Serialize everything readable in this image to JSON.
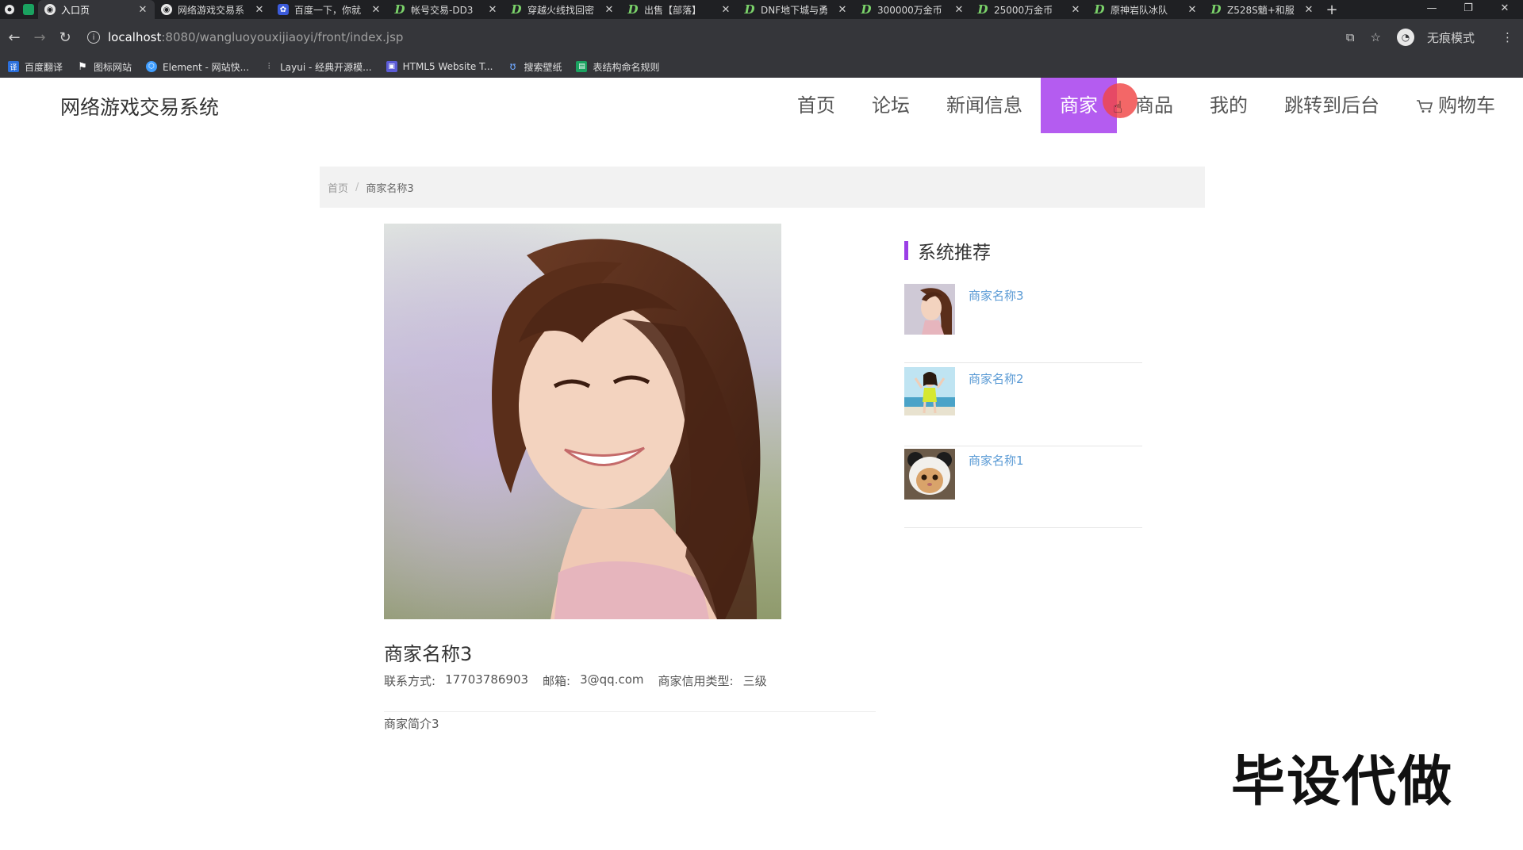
{
  "browser": {
    "tabs": [
      {
        "title": "入口页",
        "icon": "globe-icon",
        "active": true
      },
      {
        "title": "网络游戏交易系",
        "icon": "globe-icon"
      },
      {
        "title": "百度一下，你就",
        "icon": "baidu-paw-icon"
      },
      {
        "title": "帐号交易-DD3",
        "icon": "d-site-icon"
      },
      {
        "title": "穿越火线找回密",
        "icon": "d-site-icon"
      },
      {
        "title": "出售【部落】",
        "icon": "d-site-icon"
      },
      {
        "title": "DNF地下城与勇",
        "icon": "d-site-icon"
      },
      {
        "title": "300000万金币",
        "icon": "d-site-icon"
      },
      {
        "title": "25000万金币",
        "icon": "d-site-icon"
      },
      {
        "title": "原神岩队冰队",
        "icon": "d-site-icon"
      },
      {
        "title": "Z528S魈+和服",
        "icon": "d-site-icon"
      }
    ],
    "url_host": "localhost",
    "url_path": ":8080/wangluoyouxijiaoyi/front/index.jsp",
    "incognito_label": "无痕模式",
    "bookmarks": [
      {
        "label": "百度翻译",
        "color": "#2b6fdc"
      },
      {
        "label": "图标网站",
        "color": "#444444"
      },
      {
        "label": "Element - 网站快...",
        "color": "#409eff"
      },
      {
        "label": "Layui - 经典开源模...",
        "color": "#555555"
      },
      {
        "label": "HTML5 Website T...",
        "color": "#5b5bd6"
      },
      {
        "label": "搜索壁纸",
        "color": "#3b7bdc"
      },
      {
        "label": "表结构命名规则",
        "color": "#1aa260"
      }
    ]
  },
  "site": {
    "title": "网络游戏交易系统",
    "menu": [
      {
        "label": "首页"
      },
      {
        "label": "论坛"
      },
      {
        "label": "新闻信息"
      },
      {
        "label": "商家",
        "active": true
      },
      {
        "label": "商品"
      },
      {
        "label": "我的"
      },
      {
        "label": "跳转到后台"
      },
      {
        "label": "购物车",
        "icon": "cart-icon"
      }
    ],
    "accent_color": "#b45cf0"
  },
  "breadcrumb": {
    "home": "首页",
    "separator": "/",
    "current": "商家名称3"
  },
  "shop": {
    "name": "商家名称3",
    "contact_label": "联系方式:",
    "contact_value": "17703786903",
    "email_label": "邮箱:",
    "email_value": "3@qq.com",
    "credit_label": "商家信用类型:",
    "credit_value": "三级",
    "intro": "商家简介3"
  },
  "recommend": {
    "title": "系统推荐",
    "items": [
      {
        "name": "商家名称3"
      },
      {
        "name": "商家名称2"
      },
      {
        "name": "商家名称1"
      }
    ]
  },
  "watermark": "毕设代做"
}
